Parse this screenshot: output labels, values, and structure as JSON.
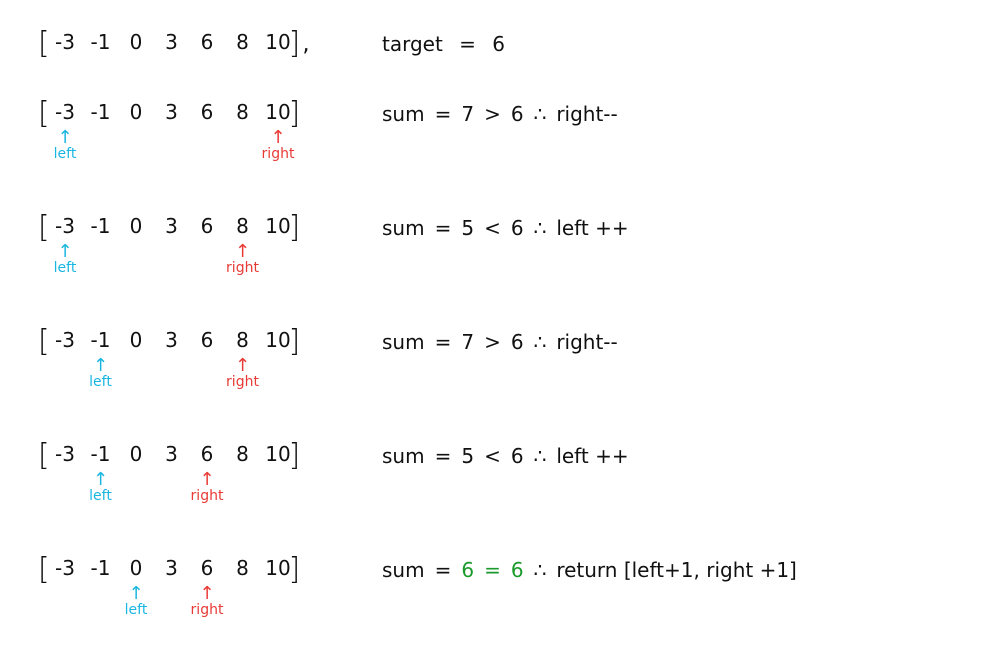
{
  "colors": {
    "left": "#1ab6e2",
    "right": "#e83a34",
    "match": "#1a9a2a",
    "ink": "#111111"
  },
  "array": [
    "-3",
    "-1",
    "0",
    "3",
    "6",
    "8",
    "10"
  ],
  "header": {
    "target_label": "target",
    "eq": "=",
    "target_value": "6",
    "comma": ","
  },
  "labels": {
    "left": "left",
    "right": "right",
    "arrow": "↑",
    "sum": "sum",
    "eq": "=",
    "therefore": "∴",
    "open": "[",
    "close": "]"
  },
  "steps": [
    {
      "left_index": 0,
      "right_index": 6,
      "sum": "7",
      "op": ">",
      "target": "6",
      "action": "right--"
    },
    {
      "left_index": 0,
      "right_index": 5,
      "sum": "5",
      "op": "<",
      "target": "6",
      "action": "left ++"
    },
    {
      "left_index": 1,
      "right_index": 5,
      "sum": "7",
      "op": ">",
      "target": "6",
      "action": "right--"
    },
    {
      "left_index": 1,
      "right_index": 4,
      "sum": "5",
      "op": "<",
      "target": "6",
      "action": "left ++"
    },
    {
      "left_index": 2,
      "right_index": 4,
      "sum": "6",
      "op": "=",
      "target": "6",
      "action": "return [left+1, right +1]",
      "match": true
    }
  ]
}
